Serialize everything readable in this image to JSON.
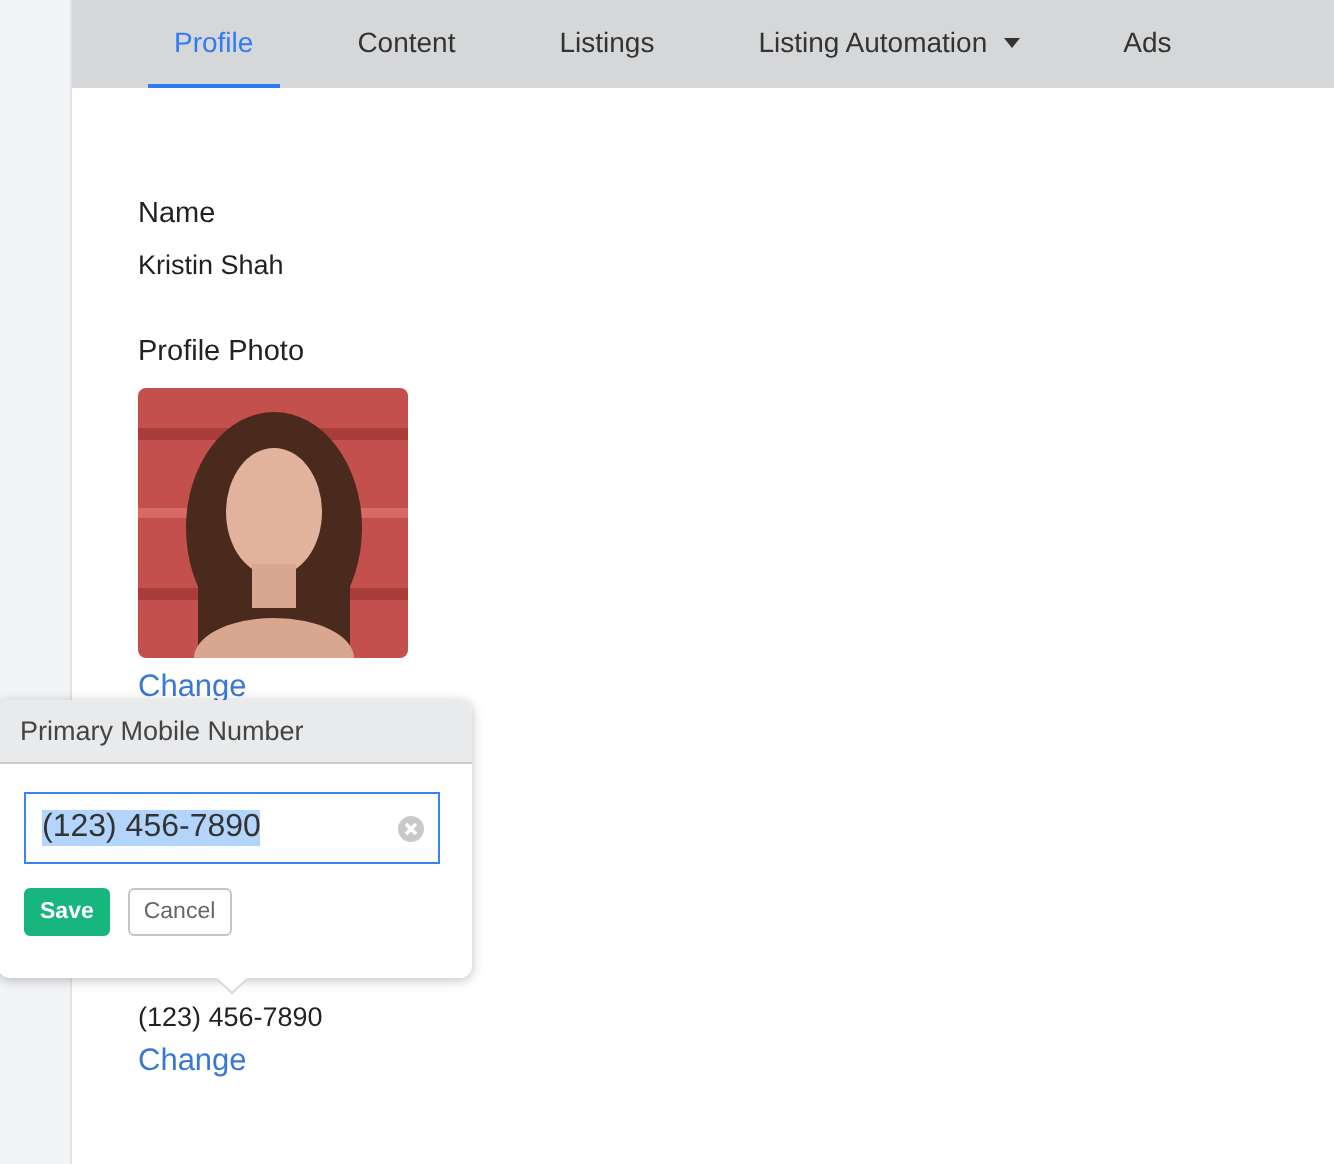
{
  "tabs": [
    {
      "label": "Profile",
      "selected": true,
      "dropdown": false
    },
    {
      "label": "Content",
      "selected": false,
      "dropdown": false
    },
    {
      "label": "Listings",
      "selected": false,
      "dropdown": false
    },
    {
      "label": "Listing Automation",
      "selected": false,
      "dropdown": true
    },
    {
      "label": "Ads",
      "selected": false,
      "dropdown": false
    }
  ],
  "fields": [
    {
      "label": "Name",
      "value": "Kristin Shah"
    },
    {
      "label": "Profile Photo",
      "kind": "picture",
      "link": "Change"
    }
  ],
  "phone": {
    "value": "(123) 456-7890",
    "link": "Change"
  },
  "popover": {
    "title": "Primary Mobile Number",
    "value": "(123) 456-7890",
    "text_selected": true,
    "buttons": [
      {
        "label": "Save",
        "kind": "primary"
      },
      {
        "label": "Cancel",
        "kind": "secondary"
      }
    ]
  }
}
